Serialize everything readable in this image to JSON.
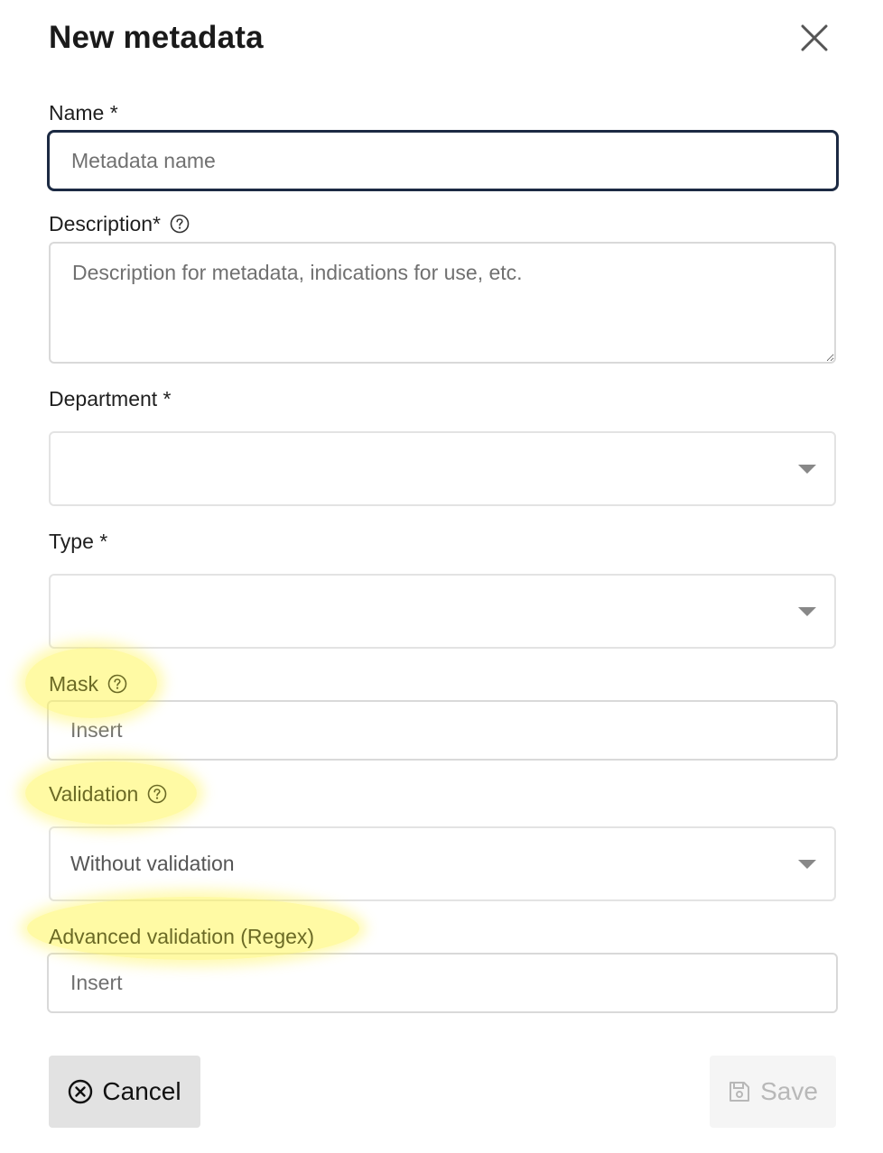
{
  "dialog": {
    "title": "New metadata"
  },
  "name": {
    "label": "Name *",
    "placeholder": "Metadata name",
    "value": ""
  },
  "description": {
    "label": "Description*",
    "placeholder": "Description for metadata, indications for use, etc.",
    "value": ""
  },
  "department": {
    "label": "Department *",
    "selected": ""
  },
  "type": {
    "label": "Type *",
    "selected": ""
  },
  "mask": {
    "label": "Mask",
    "placeholder": "Insert",
    "value": ""
  },
  "validation": {
    "label": "Validation",
    "selected": "Without validation"
  },
  "advanced_validation": {
    "label": "Advanced validation (Regex)",
    "placeholder": "Insert",
    "value": ""
  },
  "actions": {
    "cancel_label": "Cancel",
    "save_label": "Save"
  },
  "colors": {
    "focus_border": "#1c2a43",
    "highlight": "#fff55a",
    "cancel_bg": "#e2e2e2",
    "save_disabled_text": "#b8b8b8"
  }
}
